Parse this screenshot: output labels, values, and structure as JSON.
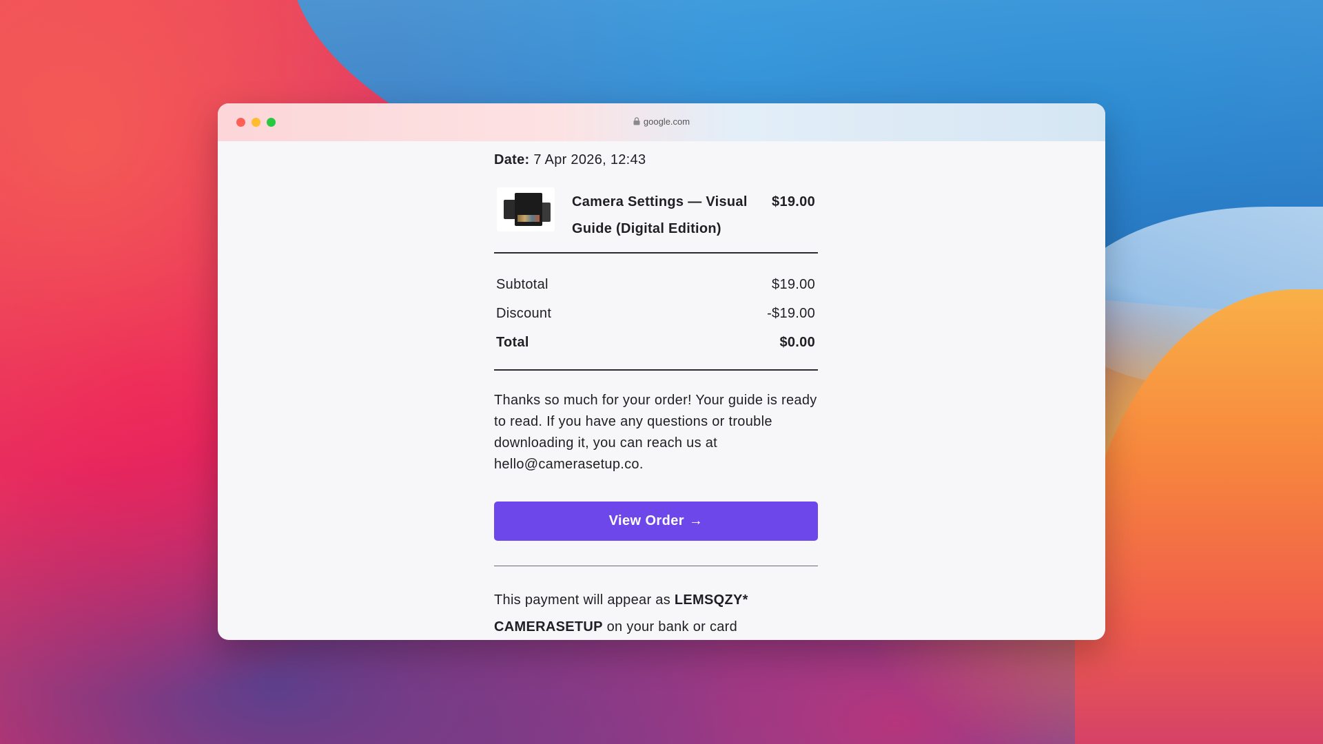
{
  "browser": {
    "url": "google.com"
  },
  "receipt": {
    "date_label": "Date:",
    "date_value": "7 Apr 2026, 12:43",
    "item": {
      "title": "Camera Settings — Visual Guide (Digital Edition)",
      "price": "$19.00"
    },
    "totals": {
      "subtotal_label": "Subtotal",
      "subtotal_value": "$19.00",
      "discount_label": "Discount",
      "discount_value": "-$19.00",
      "total_label": "Total",
      "total_value": "$0.00"
    },
    "message": "Thanks so much for your order! Your guide is ready to read. If you have any questions or trouble downloading it, you can reach us at hello@camerasetup.co.",
    "button_label": "View Order",
    "button_arrow": "→",
    "payment": {
      "prefix": "This payment will appear as",
      "descriptor": "LEMSQZY* CAMERASETUP",
      "suffix": "on your bank or card"
    }
  },
  "colors": {
    "accent": "#6e47ea",
    "traffic_red": "#fe5f57",
    "traffic_yellow": "#febc2e",
    "traffic_green": "#28c840"
  },
  "icons": [
    "lock-icon",
    "arrow-right-icon",
    "product-thumbnail"
  ]
}
